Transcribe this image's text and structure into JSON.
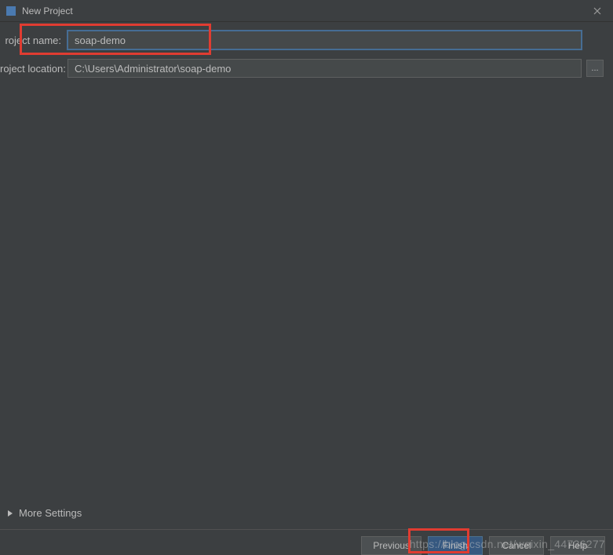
{
  "titlebar": {
    "title": "New Project"
  },
  "form": {
    "project_name_label": "roject name:",
    "project_name_value": "soap-demo",
    "project_location_label": "roject location:",
    "project_location_value": "C:\\Users\\Administrator\\soap-demo",
    "browse_label": "..."
  },
  "more_settings": {
    "label": "More Settings"
  },
  "buttons": {
    "previous": "Previous",
    "finish": "Finish",
    "cancel": "Cancel",
    "help": "Help"
  },
  "watermark": "https://blog.csdn.net/weixin_44736277"
}
